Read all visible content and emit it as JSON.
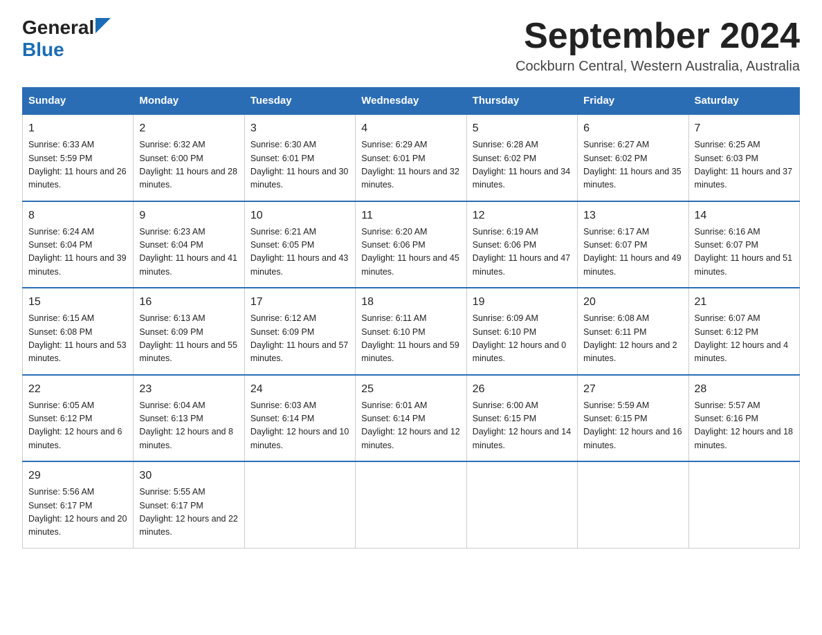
{
  "logo": {
    "general": "General",
    "blue": "Blue"
  },
  "title": "September 2024",
  "location": "Cockburn Central, Western Australia, Australia",
  "weekdays": [
    "Sunday",
    "Monday",
    "Tuesday",
    "Wednesday",
    "Thursday",
    "Friday",
    "Saturday"
  ],
  "weeks": [
    [
      {
        "day": "1",
        "sunrise": "6:33 AM",
        "sunset": "5:59 PM",
        "daylight": "11 hours and 26 minutes."
      },
      {
        "day": "2",
        "sunrise": "6:32 AM",
        "sunset": "6:00 PM",
        "daylight": "11 hours and 28 minutes."
      },
      {
        "day": "3",
        "sunrise": "6:30 AM",
        "sunset": "6:01 PM",
        "daylight": "11 hours and 30 minutes."
      },
      {
        "day": "4",
        "sunrise": "6:29 AM",
        "sunset": "6:01 PM",
        "daylight": "11 hours and 32 minutes."
      },
      {
        "day": "5",
        "sunrise": "6:28 AM",
        "sunset": "6:02 PM",
        "daylight": "11 hours and 34 minutes."
      },
      {
        "day": "6",
        "sunrise": "6:27 AM",
        "sunset": "6:02 PM",
        "daylight": "11 hours and 35 minutes."
      },
      {
        "day": "7",
        "sunrise": "6:25 AM",
        "sunset": "6:03 PM",
        "daylight": "11 hours and 37 minutes."
      }
    ],
    [
      {
        "day": "8",
        "sunrise": "6:24 AM",
        "sunset": "6:04 PM",
        "daylight": "11 hours and 39 minutes."
      },
      {
        "day": "9",
        "sunrise": "6:23 AM",
        "sunset": "6:04 PM",
        "daylight": "11 hours and 41 minutes."
      },
      {
        "day": "10",
        "sunrise": "6:21 AM",
        "sunset": "6:05 PM",
        "daylight": "11 hours and 43 minutes."
      },
      {
        "day": "11",
        "sunrise": "6:20 AM",
        "sunset": "6:06 PM",
        "daylight": "11 hours and 45 minutes."
      },
      {
        "day": "12",
        "sunrise": "6:19 AM",
        "sunset": "6:06 PM",
        "daylight": "11 hours and 47 minutes."
      },
      {
        "day": "13",
        "sunrise": "6:17 AM",
        "sunset": "6:07 PM",
        "daylight": "11 hours and 49 minutes."
      },
      {
        "day": "14",
        "sunrise": "6:16 AM",
        "sunset": "6:07 PM",
        "daylight": "11 hours and 51 minutes."
      }
    ],
    [
      {
        "day": "15",
        "sunrise": "6:15 AM",
        "sunset": "6:08 PM",
        "daylight": "11 hours and 53 minutes."
      },
      {
        "day": "16",
        "sunrise": "6:13 AM",
        "sunset": "6:09 PM",
        "daylight": "11 hours and 55 minutes."
      },
      {
        "day": "17",
        "sunrise": "6:12 AM",
        "sunset": "6:09 PM",
        "daylight": "11 hours and 57 minutes."
      },
      {
        "day": "18",
        "sunrise": "6:11 AM",
        "sunset": "6:10 PM",
        "daylight": "11 hours and 59 minutes."
      },
      {
        "day": "19",
        "sunrise": "6:09 AM",
        "sunset": "6:10 PM",
        "daylight": "12 hours and 0 minutes."
      },
      {
        "day": "20",
        "sunrise": "6:08 AM",
        "sunset": "6:11 PM",
        "daylight": "12 hours and 2 minutes."
      },
      {
        "day": "21",
        "sunrise": "6:07 AM",
        "sunset": "6:12 PM",
        "daylight": "12 hours and 4 minutes."
      }
    ],
    [
      {
        "day": "22",
        "sunrise": "6:05 AM",
        "sunset": "6:12 PM",
        "daylight": "12 hours and 6 minutes."
      },
      {
        "day": "23",
        "sunrise": "6:04 AM",
        "sunset": "6:13 PM",
        "daylight": "12 hours and 8 minutes."
      },
      {
        "day": "24",
        "sunrise": "6:03 AM",
        "sunset": "6:14 PM",
        "daylight": "12 hours and 10 minutes."
      },
      {
        "day": "25",
        "sunrise": "6:01 AM",
        "sunset": "6:14 PM",
        "daylight": "12 hours and 12 minutes."
      },
      {
        "day": "26",
        "sunrise": "6:00 AM",
        "sunset": "6:15 PM",
        "daylight": "12 hours and 14 minutes."
      },
      {
        "day": "27",
        "sunrise": "5:59 AM",
        "sunset": "6:15 PM",
        "daylight": "12 hours and 16 minutes."
      },
      {
        "day": "28",
        "sunrise": "5:57 AM",
        "sunset": "6:16 PM",
        "daylight": "12 hours and 18 minutes."
      }
    ],
    [
      {
        "day": "29",
        "sunrise": "5:56 AM",
        "sunset": "6:17 PM",
        "daylight": "12 hours and 20 minutes."
      },
      {
        "day": "30",
        "sunrise": "5:55 AM",
        "sunset": "6:17 PM",
        "daylight": "12 hours and 22 minutes."
      },
      null,
      null,
      null,
      null,
      null
    ]
  ],
  "labels": {
    "sunrise": "Sunrise: ",
    "sunset": "Sunset: ",
    "daylight": "Daylight: "
  }
}
